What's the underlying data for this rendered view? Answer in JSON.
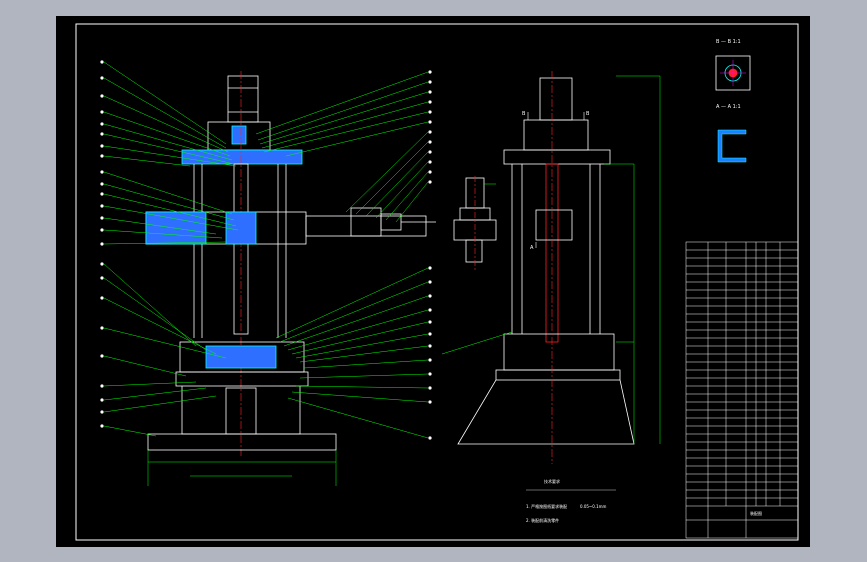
{
  "drawing": {
    "section_bb": "B — B  1:1",
    "section_aa": "A — A  1:1",
    "arrow_label_b": "B",
    "arrow_label_a": "A",
    "notes_title": "技术要求",
    "note_1": "1. 严格按图纸要求装配",
    "note_1_value": "0.05~0.1mm",
    "note_2": "2. 装配前清洗零件",
    "title_block_name": "装配图"
  },
  "colors": {
    "background": "#000000",
    "outline": "#ffffff",
    "leader": "#00ff00",
    "section": "#00ffff",
    "hatch": "#2f6fff",
    "centerline": "#ff2020",
    "accent": "#ff00ff"
  }
}
